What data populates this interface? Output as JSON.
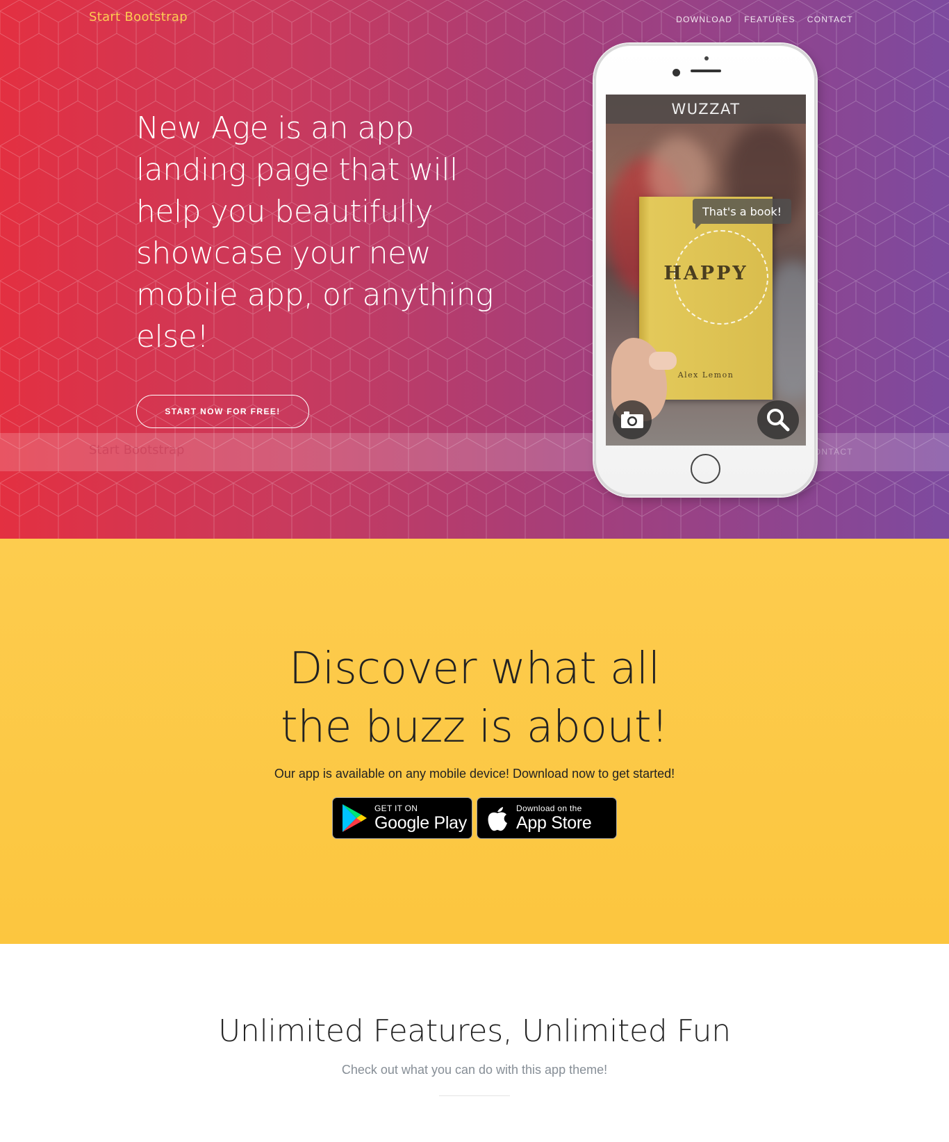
{
  "nav": {
    "brand": "Start Bootstrap",
    "links": [
      "Download",
      "Features",
      "Contact"
    ]
  },
  "hero": {
    "headline": "New Age is an app landing page that will help you beautifully showcase your new mobile app, or anything else!",
    "cta_label": "Start Now for Free!"
  },
  "phone_screen": {
    "app_title": "WUZZAT",
    "bubble_text": "That's a book!",
    "book_title": "HAPPY",
    "book_author": "Alex Lemon",
    "left_button_icon": "camera-icon",
    "right_button_icon": "magnifier-icon"
  },
  "download": {
    "heading": "Discover what all the buzz is about!",
    "subtext": "Our app is available on any mobile device! Download now to get started!",
    "google_play": {
      "small": "GET IT ON",
      "big": "Google Play",
      "icon": "google-play-icon"
    },
    "app_store": {
      "small": "Download on the",
      "big": "App Store",
      "icon": "apple-icon"
    }
  },
  "features": {
    "heading": "Unlimited Features, Unlimited Fun",
    "subtext": "Check out what you can do with this app theme!"
  },
  "colors": {
    "brand": "#fdcc52",
    "hero_gradient_start": "#e33041",
    "hero_gradient_end": "#7d4a9f",
    "download_bg": "#fdcc4e",
    "muted_text": "#868e96"
  }
}
